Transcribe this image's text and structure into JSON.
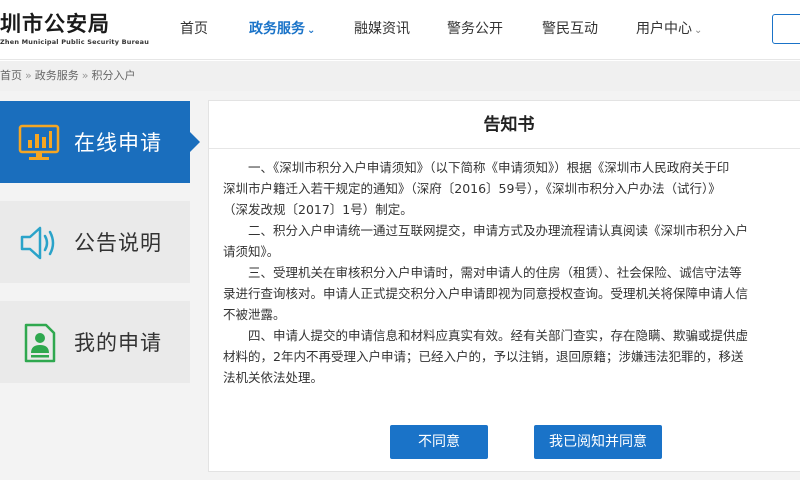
{
  "header": {
    "logo_cn": "圳市公安局",
    "logo_en": "Zhen Municipal Public Security Bureau",
    "nav": [
      {
        "label": "首页",
        "active": false,
        "dropdown": false
      },
      {
        "label": "政务服务",
        "active": true,
        "dropdown": true
      },
      {
        "label": "融媒资讯",
        "active": false,
        "dropdown": false
      },
      {
        "label": "警务公开",
        "active": false,
        "dropdown": false
      },
      {
        "label": "警民互动",
        "active": false,
        "dropdown": false
      },
      {
        "label": "用户中心",
        "active": false,
        "dropdown": true
      }
    ]
  },
  "breadcrumb": {
    "items": [
      "首页",
      "政务服务",
      "积分入户"
    ],
    "separator": "»"
  },
  "sidebar": {
    "items": [
      {
        "label": "在线申请",
        "icon": "monitor-chart-icon",
        "active": true
      },
      {
        "label": "公告说明",
        "icon": "speaker-icon",
        "active": false
      },
      {
        "label": "我的申请",
        "icon": "profile-document-icon",
        "active": false
      }
    ]
  },
  "notice": {
    "title": "告知书",
    "lines": [
      "　　一、《深圳市积分入户申请须知》（以下简称《申请须知》）根据《深圳市人民政府关于印",
      "深圳市户籍迁入若干规定的通知》（深府〔2016〕59号），《深圳市积分入户办法（试行）》",
      "（深发改规〔2017〕1号）制定。",
      "　　二、积分入户申请统一通过互联网提交，申请方式及办理流程请认真阅读《深圳市积分入户",
      "请须知》。",
      "　　三、受理机关在审核积分入户申请时，需对申请人的住房（租赁）、社会保险、诚信守法等",
      "录进行查询核对。申请人正式提交积分入户申请即视为同意授权查询。受理机关将保障申请人信",
      "不被泄露。",
      "　　四、申请人提交的申请信息和材料应真实有效。经有关部门查实，存在隐瞒、欺骗或提供虚",
      "材料的，2年内不再受理入户申请；已经入户的，予以注销，退回原籍；涉嫌违法犯罪的，移送",
      "法机关依法处理。"
    ],
    "disagree_label": "不同意",
    "agree_label": "我已阅知并同意"
  },
  "colors": {
    "accent": "#1a73c8",
    "tile_active": "#1a6ebd",
    "tile_bg": "#eaeaea",
    "icon_blue": "#1a6ebd",
    "icon_teal": "#2aa3c9",
    "icon_green": "#2fa84f"
  }
}
